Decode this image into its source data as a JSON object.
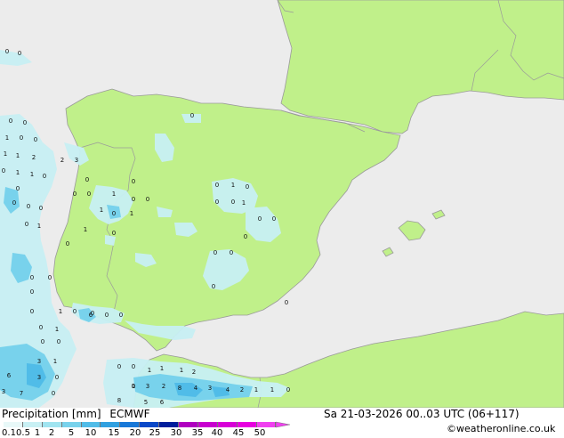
{
  "title": "Precipitation [mm]",
  "model": "ECMWF",
  "valid_time": "Sa 21-03-2026 00..03 UTC (06+117)",
  "credit": "©weatheronline.co.uk",
  "legend": {
    "ticks": [
      "0.1",
      "0.5",
      "1",
      "2",
      "5",
      "10",
      "15",
      "20",
      "25",
      "30",
      "35",
      "40",
      "45",
      "50"
    ],
    "colors": [
      "#e8f8f8",
      "#c8f0f4",
      "#a0e4f0",
      "#78d2ec",
      "#50bce8",
      "#30a0e0",
      "#1878d8",
      "#0a48c8",
      "#001e9c",
      "#b000c0",
      "#c800d0",
      "#d800d8",
      "#e800e0",
      "#f040f0"
    ]
  },
  "colors": {
    "sea": "#ececec",
    "land": "#c0f08a",
    "coast": "#9a9a9a"
  },
  "map_labels": [
    {
      "v": "0"
    },
    {
      "v": "0"
    },
    {
      "v": "0"
    },
    {
      "v": "0"
    },
    {
      "v": "0"
    },
    {
      "v": "1"
    },
    {
      "v": "0"
    },
    {
      "v": "0"
    },
    {
      "v": "1"
    },
    {
      "v": "1"
    },
    {
      "v": "2"
    },
    {
      "v": "3"
    },
    {
      "v": "0"
    },
    {
      "v": "1"
    },
    {
      "v": "1"
    },
    {
      "v": "2"
    },
    {
      "v": "0"
    },
    {
      "v": "0"
    },
    {
      "v": "0"
    },
    {
      "v": "0"
    },
    {
      "v": "1"
    },
    {
      "v": "0"
    },
    {
      "v": "0"
    },
    {
      "v": "1"
    },
    {
      "v": "0"
    },
    {
      "v": "0"
    },
    {
      "v": "0"
    },
    {
      "v": "0"
    },
    {
      "v": "0"
    },
    {
      "v": "1"
    },
    {
      "v": "0"
    },
    {
      "v": "0"
    },
    {
      "v": "0"
    },
    {
      "v": "1"
    },
    {
      "v": "0"
    },
    {
      "v": "0"
    },
    {
      "v": "1"
    },
    {
      "v": "0"
    },
    {
      "v": "0"
    },
    {
      "v": "0"
    },
    {
      "v": "1"
    },
    {
      "v": "1"
    },
    {
      "v": "0"
    },
    {
      "v": "0"
    },
    {
      "v": "0"
    },
    {
      "v": "0"
    },
    {
      "v": "0"
    },
    {
      "v": "0"
    },
    {
      "v": "0"
    },
    {
      "v": "0"
    },
    {
      "v": "0"
    },
    {
      "v": "1"
    },
    {
      "v": "0"
    },
    {
      "v": "0"
    },
    {
      "v": "0"
    },
    {
      "v": "6"
    },
    {
      "v": "0"
    },
    {
      "v": "0"
    },
    {
      "v": "0"
    },
    {
      "v": "0"
    },
    {
      "v": "1"
    },
    {
      "v": "0"
    },
    {
      "v": "0"
    },
    {
      "v": "3"
    },
    {
      "v": "1"
    },
    {
      "v": "0"
    },
    {
      "v": "0"
    },
    {
      "v": "1"
    },
    {
      "v": "1"
    },
    {
      "v": "1"
    },
    {
      "v": "2"
    },
    {
      "v": "6"
    },
    {
      "v": "3"
    },
    {
      "v": "0"
    },
    {
      "v": "3"
    },
    {
      "v": "7"
    },
    {
      "v": "0"
    },
    {
      "v": "1"
    },
    {
      "v": "8"
    },
    {
      "v": "5"
    },
    {
      "v": "6"
    },
    {
      "v": "0"
    },
    {
      "v": "3"
    },
    {
      "v": "2"
    },
    {
      "v": "8"
    },
    {
      "v": "4"
    },
    {
      "v": "3"
    },
    {
      "v": "4"
    },
    {
      "v": "2"
    },
    {
      "v": "1"
    },
    {
      "v": "1"
    },
    {
      "v": "0"
    }
  ]
}
